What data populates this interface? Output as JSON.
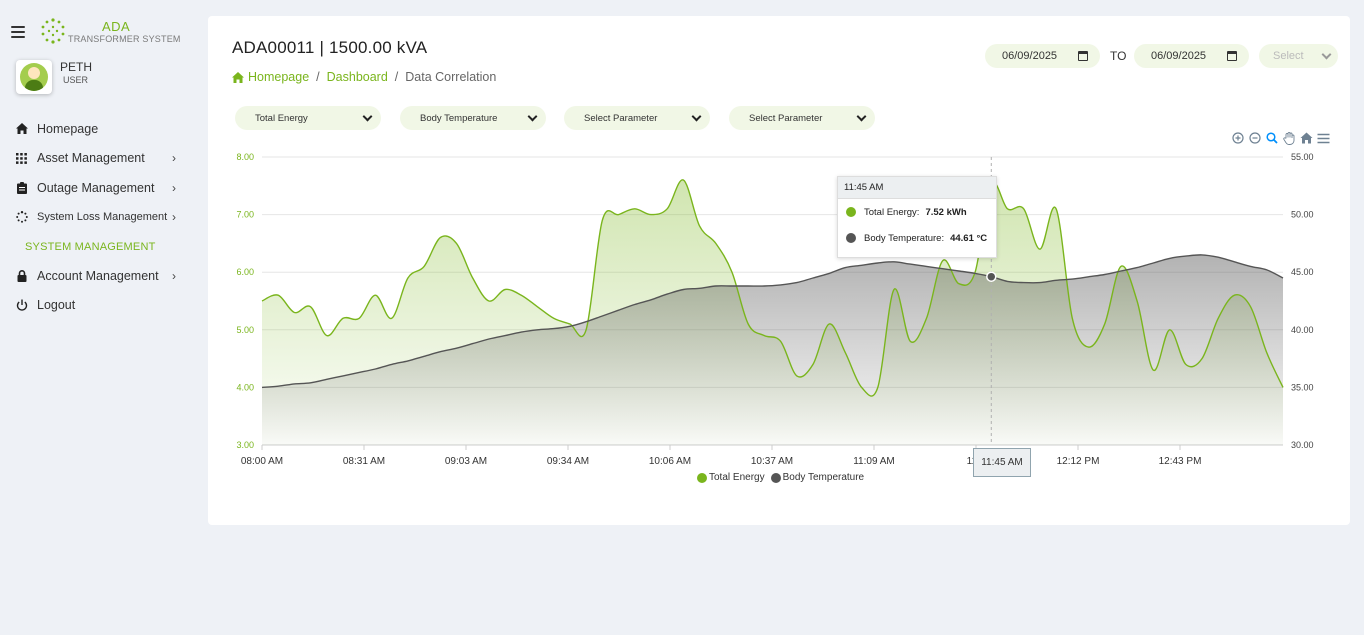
{
  "brand": {
    "name": "ADA",
    "subtitle": "TRANSFORMER SYSTEM"
  },
  "user": {
    "name": "PETH",
    "role": "USER"
  },
  "sidebar": {
    "items": [
      {
        "label": "Homepage",
        "icon": "home-icon"
      },
      {
        "label": "Asset Management",
        "icon": "grid-icon",
        "chevron": "›"
      },
      {
        "label": "Outage Management",
        "icon": "clipboard-icon",
        "chevron": "›"
      },
      {
        "label": "System Loss Management",
        "icon": "loader-icon",
        "chevron": "›"
      }
    ],
    "section": "SYSTEM MANAGEMENT",
    "items2": [
      {
        "label": "Account Management",
        "icon": "lock-icon",
        "chevron": "›"
      },
      {
        "label": "Logout",
        "icon": "power-icon"
      }
    ]
  },
  "header": {
    "title": "ADA00011 | 1500.00 kVA",
    "breadcrumb": [
      "Homepage",
      "Dashboard",
      "Data Correlation"
    ],
    "breadcrumb_sep": "/",
    "date_from": "06/09/2025",
    "to_label": "TO",
    "date_to": "06/09/2025",
    "select_placeholder": "Select"
  },
  "params": [
    "Total Energy",
    "Body Temperature",
    "Select Parameter",
    "Select Parameter"
  ],
  "colors": {
    "accent": "#7ab51d",
    "energy": "#7ab51d",
    "temperature": "#555555",
    "background": "#eef1f6"
  },
  "chart_data": {
    "type": "area",
    "x_labels": [
      "08:00 AM",
      "08:31 AM",
      "09:03 AM",
      "09:34 AM",
      "10:06 AM",
      "10:37 AM",
      "11:09 AM",
      "11:4",
      "12:12 PM",
      "12:43 PM"
    ],
    "y_left_ticks": [
      "8.00",
      "7.00",
      "6.00",
      "5.00",
      "4.00",
      "3.00"
    ],
    "y_right_ticks": [
      "55.00",
      "50.00",
      "45.00",
      "40.00",
      "35.00",
      "30.00"
    ],
    "y_left_range": [
      3,
      8
    ],
    "y_right_range": [
      30,
      55
    ],
    "legend_position": "bottom",
    "grid": true,
    "series": [
      {
        "name": "Total Energy",
        "axis": "left",
        "values": [
          5.5,
          5.6,
          5.3,
          5.4,
          4.9,
          5.2,
          5.2,
          5.6,
          5.2,
          5.9,
          6.1,
          6.6,
          6.5,
          5.9,
          5.5,
          5.7,
          5.6,
          5.4,
          5.2,
          5.1,
          5.0,
          6.9,
          7.0,
          7.1,
          7.0,
          7.1,
          7.6,
          6.8,
          6.5,
          6.0,
          5.1,
          4.9,
          4.8,
          4.2,
          4.4,
          5.1,
          4.6,
          4.0,
          4.0,
          5.7,
          4.8,
          5.2,
          6.2,
          5.8,
          6.0,
          7.52,
          7.1,
          7.1,
          6.4,
          7.1,
          5.2,
          4.7,
          5.1,
          6.1,
          5.5,
          4.3,
          5.0,
          4.4,
          4.5,
          5.2,
          5.6,
          5.4,
          4.6,
          4.0
        ]
      },
      {
        "name": "Body Temperature",
        "axis": "right",
        "values": [
          35.0,
          35.1,
          35.3,
          35.4,
          35.7,
          36.0,
          36.3,
          36.6,
          37.0,
          37.3,
          37.7,
          38.1,
          38.4,
          38.8,
          39.2,
          39.5,
          39.8,
          40.0,
          40.1,
          40.3,
          40.7,
          41.2,
          41.7,
          42.2,
          42.6,
          43.1,
          43.5,
          43.6,
          43.8,
          43.8,
          43.8,
          43.8,
          43.9,
          44.1,
          44.5,
          44.9,
          45.4,
          45.6,
          45.8,
          45.9,
          45.7,
          45.5,
          45.3,
          45.1,
          44.9,
          44.61,
          44.2,
          44.1,
          44.1,
          44.3,
          44.4,
          44.6,
          44.8,
          45.1,
          45.4,
          45.8,
          46.2,
          46.4,
          46.5,
          46.3,
          45.9,
          45.5,
          45.2,
          44.5
        ]
      }
    ]
  },
  "tooltip": {
    "time": "11:45 AM",
    "rows": [
      {
        "name": "Total Energy:",
        "value": "7.52 kWh"
      },
      {
        "name": "Body Temperature:",
        "value": "44.61 °C"
      }
    ]
  },
  "crosshair_label": "11:45 AM"
}
